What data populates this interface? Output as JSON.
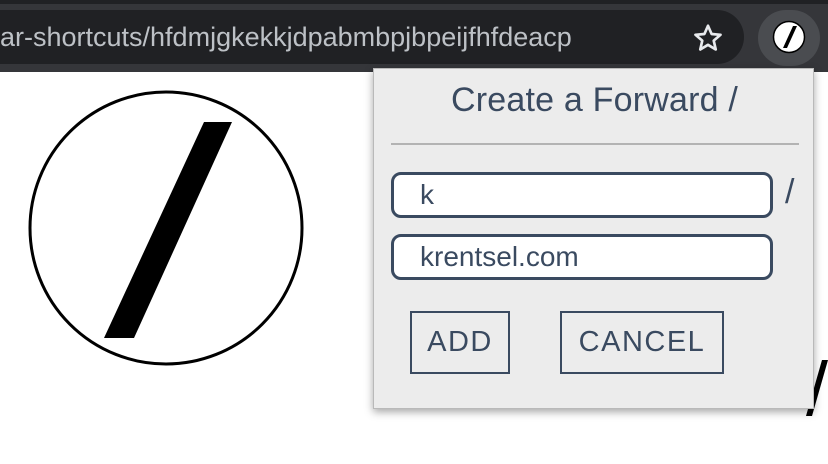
{
  "browser": {
    "url_text": "ar-shortcuts/hfdmjgkekkjdpabmbpjbpeijfhfdeacp",
    "bookmark_icon": "star-outline-icon",
    "extension_icon": "slash-circle-icon"
  },
  "page": {
    "logo_icon": "slash-circle-logo"
  },
  "popup": {
    "title": "Create a Forward /",
    "shortcut_value": "k",
    "separator": "/",
    "url_value": "krentsel.com",
    "add_label": "ADD",
    "cancel_label": "CANCEL"
  },
  "colors": {
    "toolbar_bg": "#35363a",
    "omnibox_bg": "#202124",
    "popup_bg": "#ececec",
    "accent": "#3a4a60"
  }
}
